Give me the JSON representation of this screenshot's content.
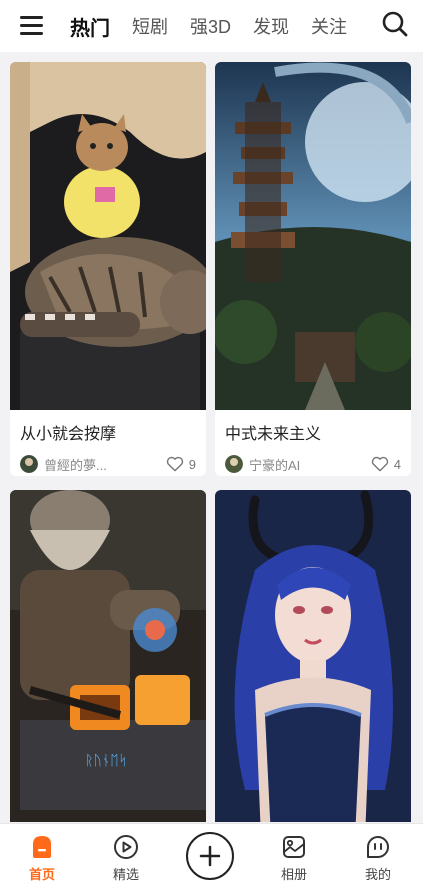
{
  "header": {
    "tabs": [
      {
        "label": "热门",
        "active": true
      },
      {
        "label": "短剧",
        "active": false
      },
      {
        "label": "强3D",
        "active": false
      },
      {
        "label": "发现",
        "active": false
      },
      {
        "label": "关注",
        "active": false
      }
    ],
    "menu_icon": "hamburger-icon",
    "search_icon": "search-icon"
  },
  "feed": {
    "cards": [
      {
        "title": "从小就会按摩",
        "author": "曾經的夢...",
        "likes": "9",
        "image": "cats-photo"
      },
      {
        "title": "中式未来主义",
        "author": "宁豪的AI",
        "likes": "4",
        "image": "futuristic-pagoda-city"
      },
      {
        "title": "",
        "author": "",
        "likes": "",
        "image": "blacksmith-forge"
      },
      {
        "title": "",
        "author": "",
        "likes": "",
        "image": "blue-haired-horned-girl"
      }
    ]
  },
  "bottom_nav": {
    "items": [
      {
        "label": "首页",
        "icon": "home-icon",
        "active": true
      },
      {
        "label": "精选",
        "icon": "play-circle-icon",
        "active": false
      },
      {
        "label": "",
        "icon": "plus-circle-icon",
        "active": false
      },
      {
        "label": "相册",
        "icon": "album-icon",
        "active": false
      },
      {
        "label": "我的",
        "icon": "profile-icon",
        "active": false
      }
    ]
  },
  "colors": {
    "accent": "#ff6a1a",
    "background": "#f2f2f4"
  }
}
